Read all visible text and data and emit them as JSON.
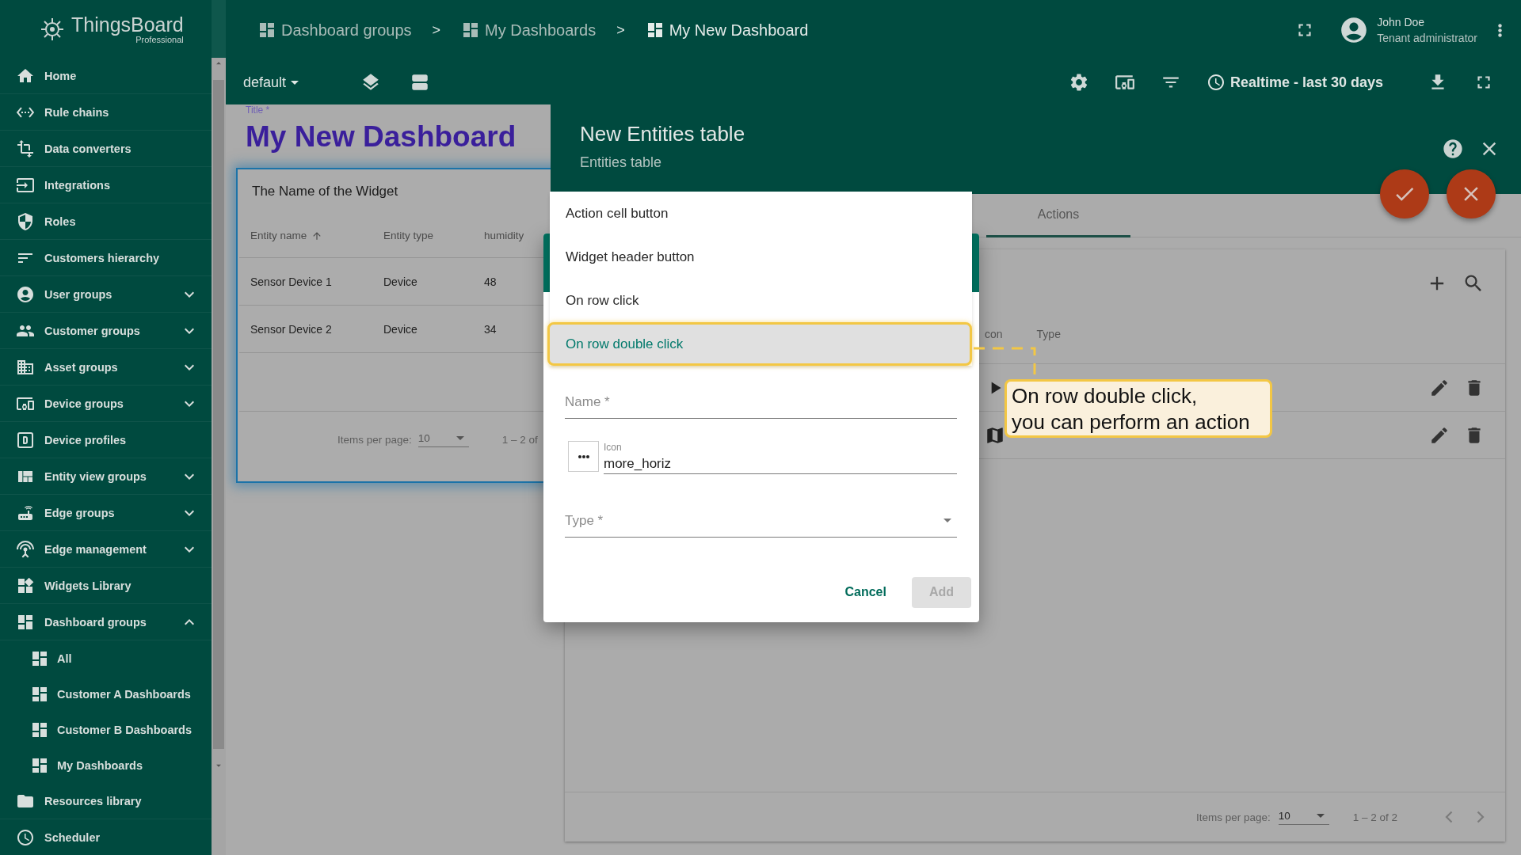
{
  "sidebar": {
    "logo": {
      "name": "ThingsBoard",
      "edition": "Professional"
    },
    "items": [
      {
        "label": "Home"
      },
      {
        "label": "Rule chains"
      },
      {
        "label": "Data converters"
      },
      {
        "label": "Integrations"
      },
      {
        "label": "Roles"
      },
      {
        "label": "Customers hierarchy"
      },
      {
        "label": "User groups",
        "expanded": false
      },
      {
        "label": "Customer groups",
        "expanded": false
      },
      {
        "label": "Asset groups",
        "expanded": false
      },
      {
        "label": "Device groups",
        "expanded": false
      },
      {
        "label": "Device profiles"
      },
      {
        "label": "Entity view groups",
        "expanded": false
      },
      {
        "label": "Edge groups",
        "expanded": false
      },
      {
        "label": "Edge management",
        "expanded": false
      },
      {
        "label": "Widgets Library"
      },
      {
        "label": "Dashboard groups",
        "expanded": true,
        "children": [
          {
            "label": "All"
          },
          {
            "label": "Customer A Dashboards"
          },
          {
            "label": "Customer B Dashboards"
          },
          {
            "label": "My Dashboards"
          }
        ]
      },
      {
        "label": "Resources library"
      },
      {
        "label": "Scheduler"
      }
    ]
  },
  "breadcrumbs": [
    {
      "kind": "crumb",
      "label": "Dashboard groups",
      "current": false
    },
    {
      "kind": "separator",
      "label": ">"
    },
    {
      "kind": "crumb",
      "label": "My Dashboards",
      "current": false
    },
    {
      "kind": "separator",
      "label": ">"
    },
    {
      "kind": "crumb",
      "label": "My New Dashboard",
      "current": true
    }
  ],
  "user": {
    "name": "John Doe",
    "role": "Tenant administrator"
  },
  "toolbar": {
    "state": "default",
    "timewindow": "Realtime - last 30 days"
  },
  "dashboard": {
    "title_label": "Title *",
    "title": "My New Dashboard",
    "widget": {
      "title": "The Name of the Widget",
      "columns": [
        {
          "label": "Entity name",
          "sorted": true
        },
        {
          "label": "Entity type",
          "sorted": false
        },
        {
          "label": "humidity",
          "sorted": false
        }
      ],
      "rows": [
        [
          "Sensor Device 1",
          "Device",
          "48"
        ],
        [
          "Sensor Device 2",
          "Device",
          "34"
        ]
      ],
      "pagination": {
        "label": "Items per page:",
        "page_size": "10",
        "range": "1 – 2 of"
      }
    }
  },
  "panel": {
    "title": "New Entities table",
    "subtitle": "Entities table",
    "tabs": [
      {
        "label": "Actions",
        "selected": true
      }
    ],
    "table": {
      "columns": [
        "con",
        "Type"
      ],
      "rows": [
        {
          "kind": "action"
        },
        {
          "kind": "action"
        }
      ],
      "pagination": {
        "label": "Items per page:",
        "page_size": "10",
        "range": "1 – 2 of 2"
      }
    }
  },
  "dialog": {
    "menu": [
      {
        "label": "Action cell button",
        "selected": false
      },
      {
        "label": "Widget header button",
        "selected": false
      },
      {
        "label": "On row click",
        "selected": false
      },
      {
        "label": "On row double click",
        "selected": true
      }
    ],
    "fields": [
      {
        "kind": "text",
        "placeholder": "Name *"
      },
      {
        "kind": "icon",
        "label": "Icon",
        "value": "more_horiz"
      },
      {
        "kind": "select",
        "placeholder": "Type *"
      }
    ],
    "buttons": [
      {
        "kind": "text",
        "label": "Cancel",
        "disabled": false
      },
      {
        "kind": "raised",
        "label": "Add",
        "disabled": true
      }
    ]
  },
  "callout": {
    "text": "On row double click,\nyou can perform an action"
  }
}
